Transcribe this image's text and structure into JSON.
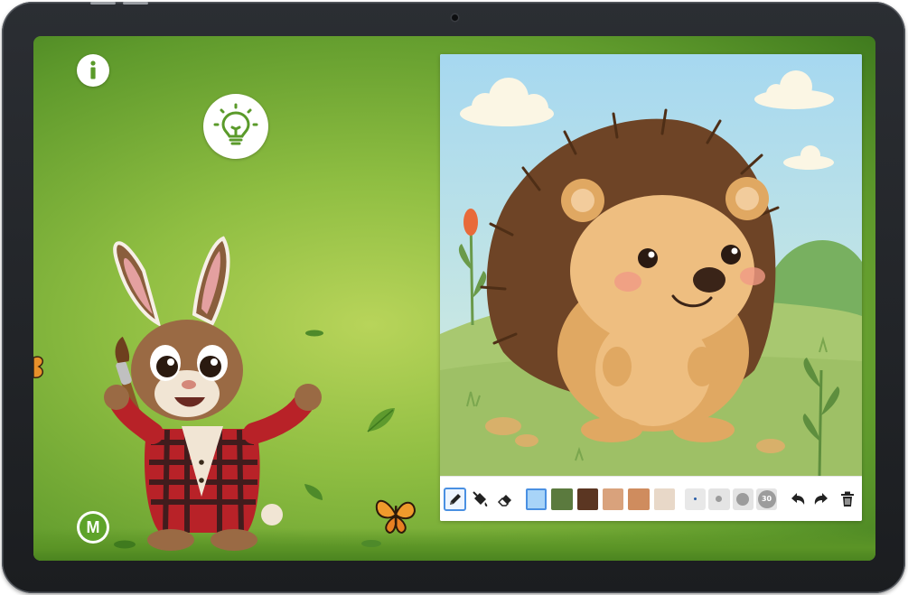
{
  "colors": {
    "accent": "#4a90e2",
    "brand_green": "#5ea32a",
    "screen_green": "#8fbe42"
  },
  "hud": {
    "info_icon": "info-icon",
    "idea_icon": "lightbulb-icon",
    "brand_badge": {
      "letter": "M",
      "icon": "brand-logo-icon"
    }
  },
  "drawing": {
    "subject": "hedgehog",
    "tools": [
      {
        "id": "pencil",
        "icon": "pencil-icon",
        "active": true
      },
      {
        "id": "fill",
        "icon": "paint-bucket-icon",
        "active": false
      },
      {
        "id": "eraser",
        "icon": "eraser-icon",
        "active": false
      }
    ],
    "palette": [
      {
        "hex": "#a8d4f8",
        "active": true
      },
      {
        "hex": "#5b7a3e",
        "active": false
      },
      {
        "hex": "#5b3622",
        "active": false
      },
      {
        "hex": "#d9a27c",
        "active": false
      },
      {
        "hex": "#cf8c5e",
        "active": false
      },
      {
        "hex": "#e8d8c8",
        "active": false
      }
    ],
    "brush_sizes": [
      {
        "dot": "tiny",
        "active": true
      },
      {
        "dot": "small",
        "active": false
      },
      {
        "dot": "medium",
        "active": false
      },
      {
        "label": "30",
        "active": false
      }
    ],
    "actions": [
      {
        "id": "undo",
        "icon": "undo-icon"
      },
      {
        "id": "redo",
        "icon": "redo-icon"
      },
      {
        "id": "clear",
        "icon": "trash-icon"
      }
    ]
  }
}
